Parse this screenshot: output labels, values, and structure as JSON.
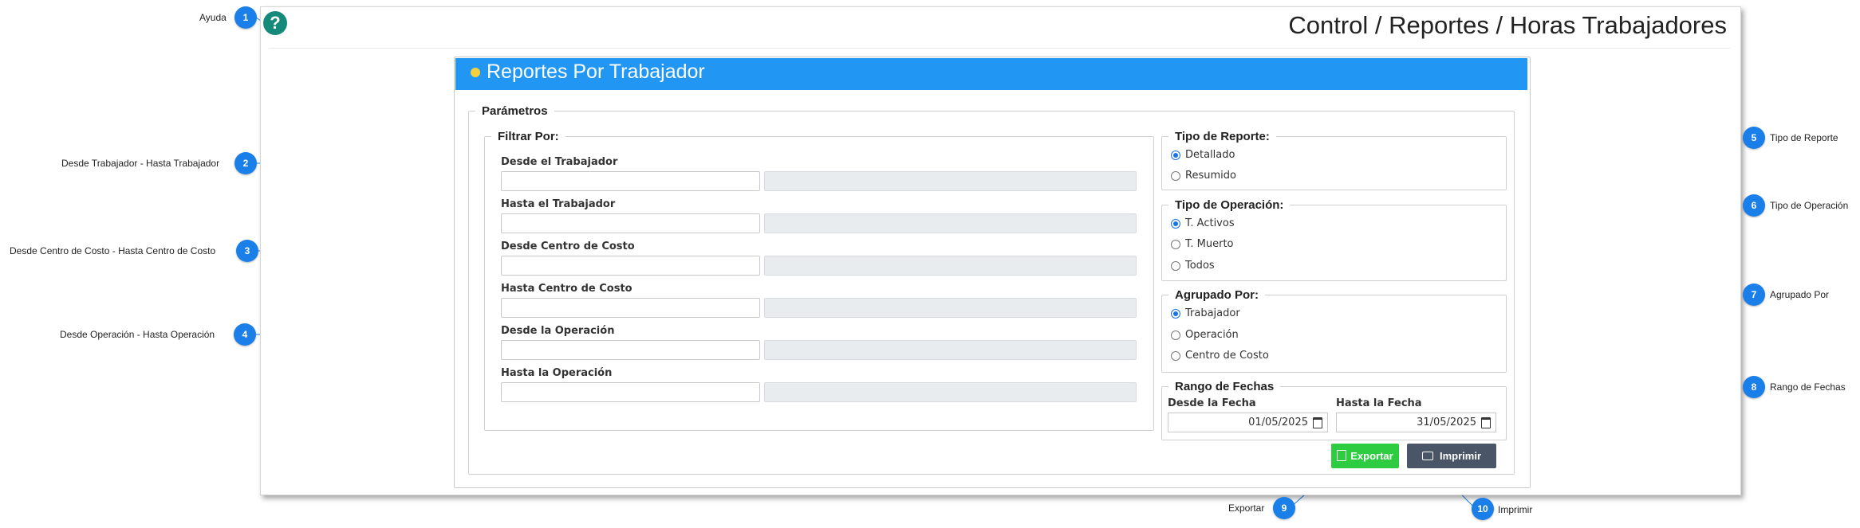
{
  "page_title": "Control / Reportes / Horas Trabajadores",
  "help_icon": "question-circle-icon",
  "panel": {
    "title": "Reportes Por Trabajador"
  },
  "parametros": {
    "legend": "Parámetros",
    "filtrar": {
      "legend": "Filtrar Por:",
      "fields": [
        {
          "label": "Desde el Trabajador",
          "code": "",
          "description": ""
        },
        {
          "label": "Hasta el Trabajador",
          "code": "",
          "description": ""
        },
        {
          "label": "Desde Centro de Costo",
          "code": "",
          "description": ""
        },
        {
          "label": "Hasta Centro de Costo",
          "code": "",
          "description": ""
        },
        {
          "label": "Desde la Operación",
          "code": "",
          "description": ""
        },
        {
          "label": "Hasta la Operación",
          "code": "",
          "description": ""
        }
      ]
    },
    "tipo_reporte": {
      "legend": "Tipo de Reporte:",
      "options": [
        "Detallado",
        "Resumido"
      ],
      "selected": "Detallado"
    },
    "tipo_operacion": {
      "legend": "Tipo de Operación:",
      "options": [
        "T. Activos",
        "T. Muerto",
        "Todos"
      ],
      "selected": "T. Activos"
    },
    "agrupado": {
      "legend": "Agrupado Por:",
      "options": [
        "Trabajador",
        "Operación",
        "Centro de Costo"
      ],
      "selected": "Trabajador"
    },
    "rango": {
      "legend": "Rango de Fechas",
      "desde_label": "Desde la Fecha",
      "desde_value": "01/05/2025",
      "hasta_label": "Hasta la Fecha",
      "hasta_value": "31/05/2025"
    }
  },
  "buttons": {
    "exportar": "Exportar",
    "imprimir": "Imprimir"
  },
  "colors": {
    "accent": "#2196f3",
    "export": "#2ecc40",
    "print": "#4a5568",
    "callout": "#1a7fe8",
    "help": "#168a7a"
  },
  "callouts": [
    {
      "num": "1",
      "text": "Ayuda"
    },
    {
      "num": "2",
      "text": "Desde Trabajador - Hasta Trabajador"
    },
    {
      "num": "3",
      "text": "Desde Centro de Costo - Hasta Centro de Costo"
    },
    {
      "num": "4",
      "text": "Desde Operación - Hasta Operación"
    },
    {
      "num": "5",
      "text": "Tipo de Reporte"
    },
    {
      "num": "6",
      "text": "Tipo de Operación"
    },
    {
      "num": "7",
      "text": "Agrupado Por"
    },
    {
      "num": "8",
      "text": "Rango de Fechas"
    },
    {
      "num": "9",
      "text": "Exportar"
    },
    {
      "num": "10",
      "text": "Imprimir"
    }
  ]
}
